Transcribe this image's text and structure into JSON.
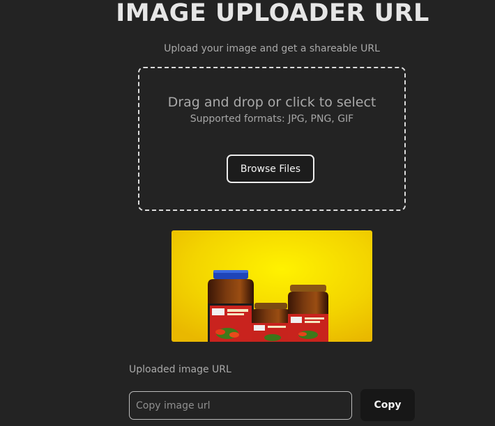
{
  "header": {
    "title": "IMAGE UPLOADER URL",
    "subtitle": "Upload your image and get a shareable URL"
  },
  "dropzone": {
    "main_text": "Drag and drop or click to select",
    "formats_text": "Supported formats: JPG, PNG, GIF",
    "browse_label": "Browse Files"
  },
  "preview": {
    "background_color": "#f5d800"
  },
  "url_section": {
    "label": "Uploaded image URL",
    "input_placeholder": "Copy image url",
    "input_value": "",
    "copy_label": "Copy"
  }
}
